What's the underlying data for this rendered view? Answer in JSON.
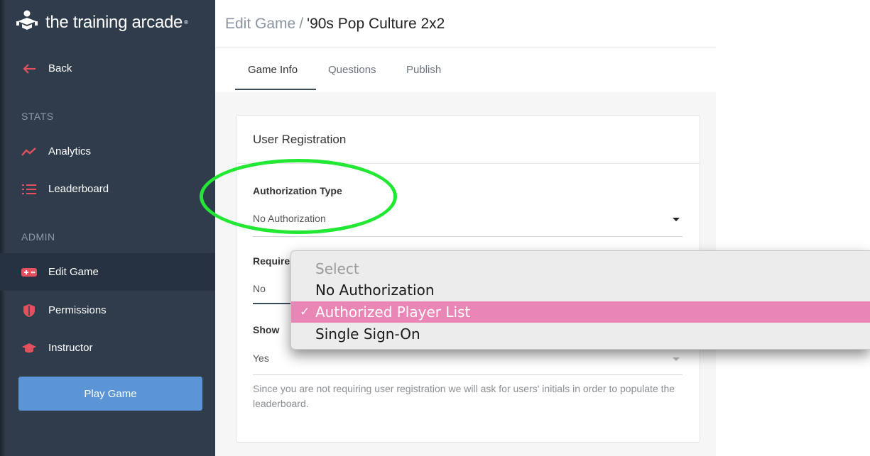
{
  "brand": {
    "name": "the training arcade",
    "reg_mark": "®"
  },
  "sidebar": {
    "back": "Back",
    "sections": {
      "stats": "STATS",
      "admin": "ADMIN"
    },
    "items": [
      {
        "label": "Analytics",
        "icon": "analytics-icon"
      },
      {
        "label": "Leaderboard",
        "icon": "leaderboard-icon"
      },
      {
        "label": "Edit Game",
        "icon": "gamepad-icon",
        "active": true
      },
      {
        "label": "Permissions",
        "icon": "shield-icon"
      },
      {
        "label": "Instructor",
        "icon": "graduation-cap-icon"
      }
    ],
    "play_button": "Play Game"
  },
  "header": {
    "crumb": "Edit Game",
    "separator": "/",
    "title": "'90s Pop Culture 2x2"
  },
  "tabs": [
    {
      "label": "Game Info",
      "active": true
    },
    {
      "label": "Questions"
    },
    {
      "label": "Publish"
    }
  ],
  "card": {
    "title": "User Registration",
    "fields": [
      {
        "label": "Authorization Type",
        "value": "No Authorization"
      },
      {
        "label": "Require",
        "value": "No"
      },
      {
        "label": "Show",
        "value": "Yes"
      }
    ],
    "help_text": "Since you are not requiring user registration we will ask for users' initials in order to populate the leaderboard."
  },
  "dropdown": {
    "options": [
      {
        "label": "Select",
        "disabled": true
      },
      {
        "label": "No Authorization"
      },
      {
        "label": "Authorized Player List",
        "selected": true,
        "check": "✓"
      },
      {
        "label": "Single Sign-On"
      }
    ]
  },
  "colors": {
    "sidebar_bg": "#2f3c4b",
    "accent_red": "#e2515d",
    "play_button": "#5b95d6",
    "selected_option": "#ea86b5",
    "annotation": "#22e834"
  }
}
